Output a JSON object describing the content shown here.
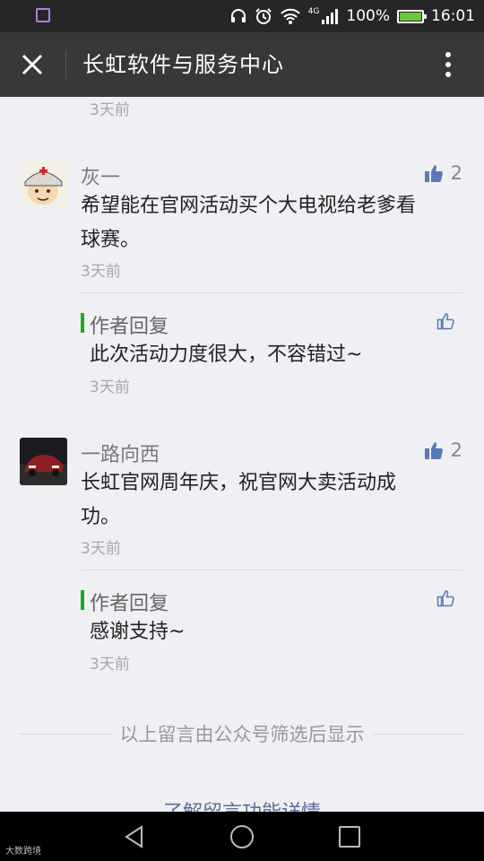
{
  "status_bar": {
    "network": "4G",
    "battery": "100%",
    "time": "16:01"
  },
  "header": {
    "title": "长虹软件与服务中心"
  },
  "top_partial": {
    "time": "3天前"
  },
  "comments": [
    {
      "user": "灰一",
      "likes": "2",
      "text_line1": "希望能在官网活动买个大电视给老爹看",
      "text_line2": "球赛。",
      "time": "3天前",
      "reply": {
        "label": "作者回复",
        "text": "此次活动力度很大，不容错过~",
        "time": "3天前"
      }
    },
    {
      "user": "一路向西",
      "likes": "2",
      "text_line1": "长虹官网周年庆，祝官网大卖活动成",
      "text_line2": "功。",
      "time": "3天前",
      "reply": {
        "label": "作者回复",
        "text": "感谢支持~",
        "time": "3天前"
      }
    }
  ],
  "footer": {
    "note": "以上留言由公众号筛选后显示",
    "learn_more": "了解留言功能详情"
  },
  "watermark": "大数跨境",
  "colors": {
    "title_bar": "#383838",
    "status_bar": "#262626",
    "page_bg": "#efeff4",
    "reply_accent": "#1aad19",
    "like_icon": "#5b79b5",
    "link": "#5b6e94"
  }
}
